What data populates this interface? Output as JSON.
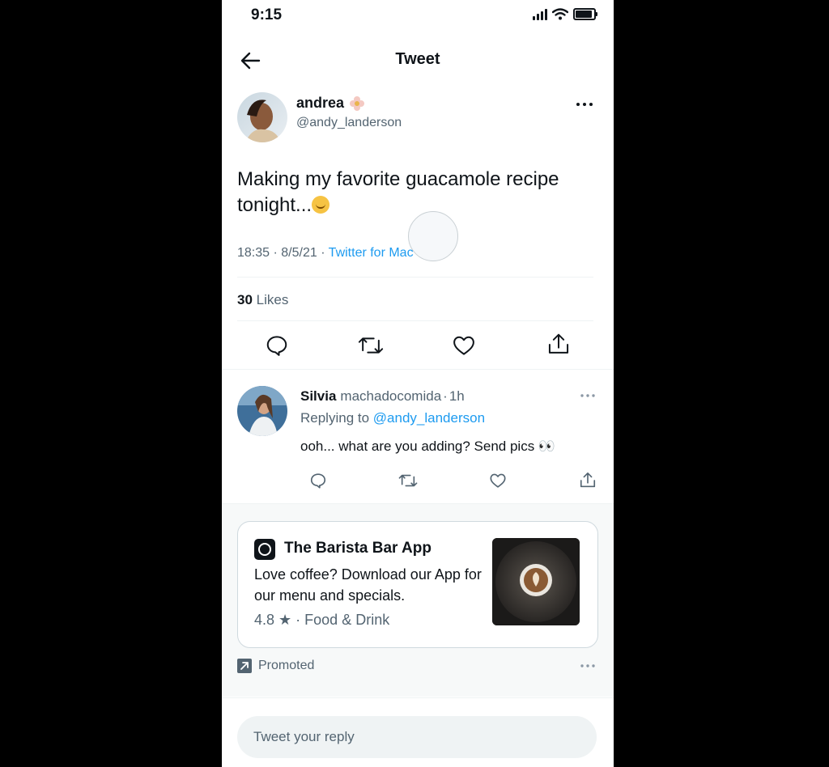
{
  "status_bar": {
    "time": "9:15"
  },
  "header": {
    "title": "Tweet"
  },
  "tweet": {
    "author_name": "andrea",
    "handle": "@andy_landerson",
    "text": "Making my favorite guacamole recipe tonight...",
    "time": "18:35 · 8/5/21 · ",
    "source": "Twitter for Mac",
    "likes_count": "30",
    "likes_label": " Likes"
  },
  "reply": {
    "name": "Silvia",
    "handle": "machadocomida",
    "dot": "·",
    "time": "1h",
    "replying_prefix": "Replying to ",
    "replying_to": "@andy_landerson",
    "text": "ooh... what are you adding? Send pics 👀"
  },
  "ad": {
    "title": "The Barista Bar App",
    "description": "Love coffee? Download our App for our menu and specials.",
    "rating": "4.8 ★",
    "category": " · Food & Drink",
    "promoted_label": "Promoted"
  },
  "composer": {
    "placeholder": "Tweet your reply"
  },
  "colors": {
    "accent": "#1d9bf0",
    "text": "#0f1419",
    "muted": "#536471"
  }
}
